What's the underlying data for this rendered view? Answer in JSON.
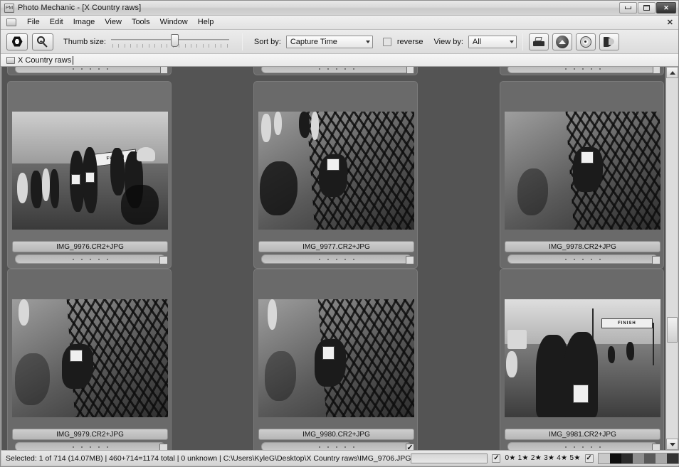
{
  "window": {
    "title": "Photo Mechanic - [X Country raws]",
    "icon": "app-icon",
    "buttons": {
      "minimize": "minimize",
      "maximize": "maximize",
      "close": "✕"
    },
    "document_close": "✕"
  },
  "menu": {
    "folder_icon": "folder-icon",
    "items": [
      {
        "label": "File",
        "accel": "F"
      },
      {
        "label": "Edit",
        "accel": "E"
      },
      {
        "label": "Image",
        "accel": "I"
      },
      {
        "label": "View",
        "accel": "V"
      },
      {
        "label": "Tools",
        "accel": "T"
      },
      {
        "label": "Window",
        "accel": "W"
      },
      {
        "label": "Help",
        "accel": "H"
      }
    ]
  },
  "toolbar": {
    "contact_sheet_button": "contact-sheet",
    "zoom_button": "zoom-in",
    "thumb_size_label": "Thumb size:",
    "thumb_size_value": 50,
    "sort_by_label": "Sort by:",
    "sort_by_value": "Capture Time",
    "reverse_label": "reverse",
    "reverse_checked": false,
    "view_by_label": "View by:",
    "view_by_value": "All",
    "right_buttons": [
      {
        "name": "print-icon"
      },
      {
        "name": "upload-icon"
      },
      {
        "name": "disc-icon"
      },
      {
        "name": "page-icon"
      }
    ]
  },
  "tabbar": {
    "folder_icon": "folder-icon",
    "label": "X Country raws"
  },
  "contact_sheet": {
    "clipped_row": [
      {
        "name": "clipped-cell-1"
      },
      {
        "name": "clipped-cell-2"
      },
      {
        "name": "clipped-cell-3"
      }
    ],
    "cells": [
      {
        "filename": "IMG_9976.CR2+JPG",
        "checked": false,
        "selected": true,
        "art": "finish-hug"
      },
      {
        "filename": "IMG_9977.CR2+JPG",
        "checked": false,
        "selected": false,
        "art": "net-fallen"
      },
      {
        "filename": "IMG_9978.CR2+JPG",
        "checked": false,
        "selected": false,
        "art": "net-fallen"
      },
      {
        "filename": "IMG_9979.CR2+JPG",
        "checked": false,
        "selected": false,
        "art": "net-fallen"
      },
      {
        "filename": "IMG_9980.CR2+JPG",
        "checked": true,
        "selected": false,
        "art": "net-fallen"
      },
      {
        "filename": "IMG_9981.CR2+JPG",
        "checked": false,
        "selected": false,
        "art": "finish-embrace"
      }
    ],
    "rating_dots": 5
  },
  "scrollbar": {
    "up_arrow": "scroll-up",
    "down_arrow": "scroll-down",
    "thumb": "scroll-thumb"
  },
  "statusbar": {
    "text": "Selected: 1 of 714 (14.07MB) | 460+714=1174 total | 0 unknown | C:\\Users\\KyleG\\Desktop\\X Country raws\\IMG_9706.JPG",
    "progress_value": 0,
    "filter_checkbox_1_checked": true,
    "stars_label": "0★ 1★ 2★ 3★ 4★ 5★",
    "filter_checkbox_2_checked": true,
    "color_swatches": [
      "#c9c9c9",
      "#0d0d0d",
      "#2b2b2b",
      "#8f8f8f",
      "#5a5a5a",
      "#a8a8a8",
      "#343434",
      "#6e6e6e",
      "checker"
    ]
  }
}
